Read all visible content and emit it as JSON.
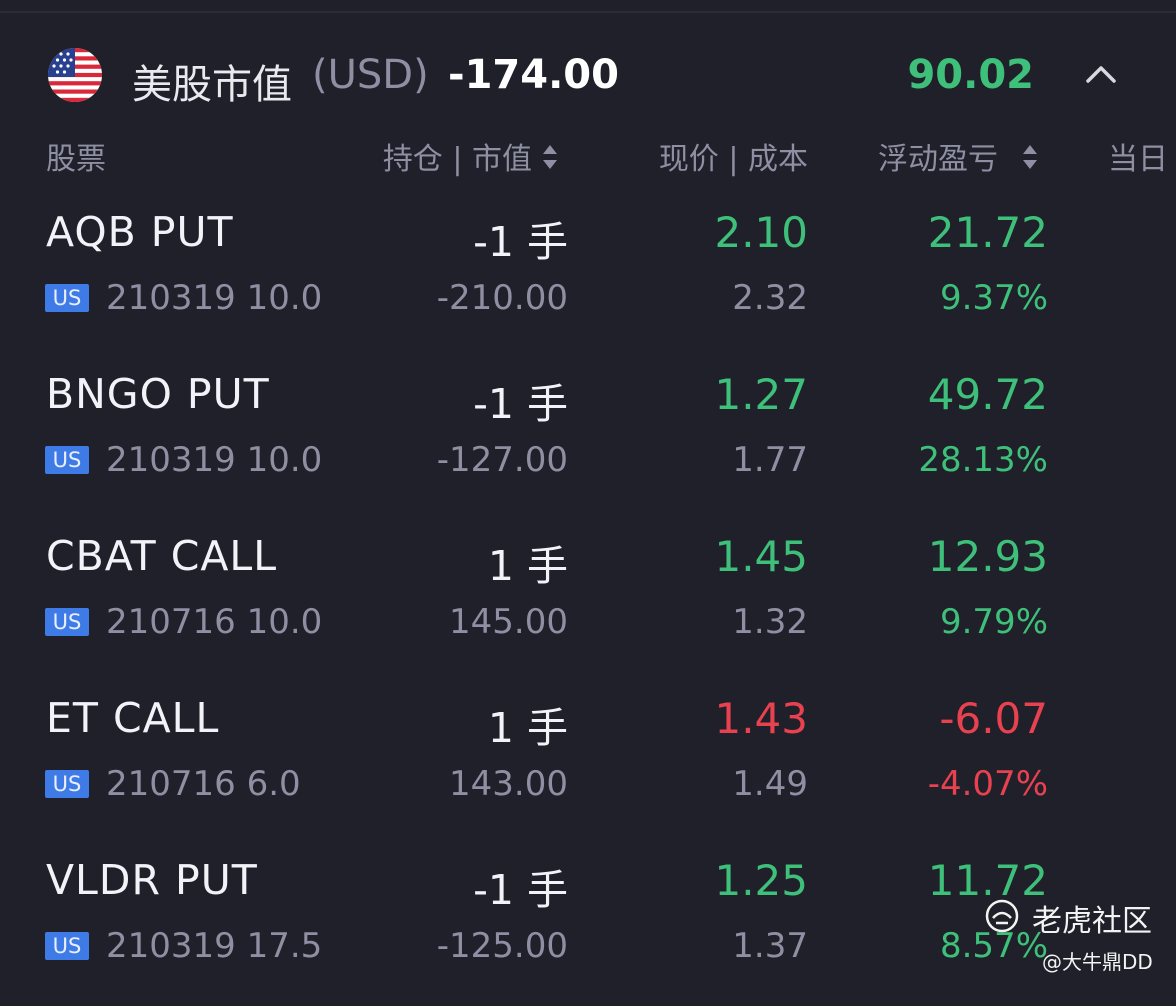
{
  "header": {
    "title": "美股市值",
    "currency": "(USD)",
    "market_value": "-174.00",
    "floating_pnl": "90.02"
  },
  "columns": {
    "stock": "股票",
    "position_value": "持仓 | 市值",
    "price_cost": "现价 | 成本",
    "floating_pnl": "浮动盈亏",
    "today": "当日"
  },
  "rows": [
    {
      "symbol": "AQB PUT",
      "market_badge": "US",
      "contract": "210319 10.0",
      "qty": "-1 手",
      "market_value": "-210.00",
      "price": "2.10",
      "cost": "2.32",
      "pnl": "21.72",
      "pnl_pct": "9.37%",
      "direction": "up"
    },
    {
      "symbol": "BNGO PUT",
      "market_badge": "US",
      "contract": "210319 10.0",
      "qty": "-1 手",
      "market_value": "-127.00",
      "price": "1.27",
      "cost": "1.77",
      "pnl": "49.72",
      "pnl_pct": "28.13%",
      "direction": "up"
    },
    {
      "symbol": "CBAT CALL",
      "market_badge": "US",
      "contract": "210716 10.0",
      "qty": "1 手",
      "market_value": "145.00",
      "price": "1.45",
      "cost": "1.32",
      "pnl": "12.93",
      "pnl_pct": "9.79%",
      "direction": "up"
    },
    {
      "symbol": "ET CALL",
      "market_badge": "US",
      "contract": "210716 6.0",
      "qty": "1 手",
      "market_value": "143.00",
      "price": "1.43",
      "cost": "1.49",
      "pnl": "-6.07",
      "pnl_pct": "-4.07%",
      "direction": "down"
    },
    {
      "symbol": "VLDR PUT",
      "market_badge": "US",
      "contract": "210319 17.5",
      "qty": "-1 手",
      "market_value": "-125.00",
      "price": "1.25",
      "cost": "1.37",
      "pnl": "11.72",
      "pnl_pct": "8.57%",
      "direction": "up"
    }
  ],
  "watermark": {
    "brand": "老虎社区",
    "user": "@大牛鼎DD"
  },
  "colors": {
    "background": "#1f2029",
    "up": "#3fc07a",
    "down": "#e8414f",
    "muted": "#8e8fa3",
    "badge": "#3f7be6"
  },
  "icons": {
    "flag": "us-flag-icon",
    "collapse": "chevron-up-icon",
    "sort": "sort-icon"
  }
}
